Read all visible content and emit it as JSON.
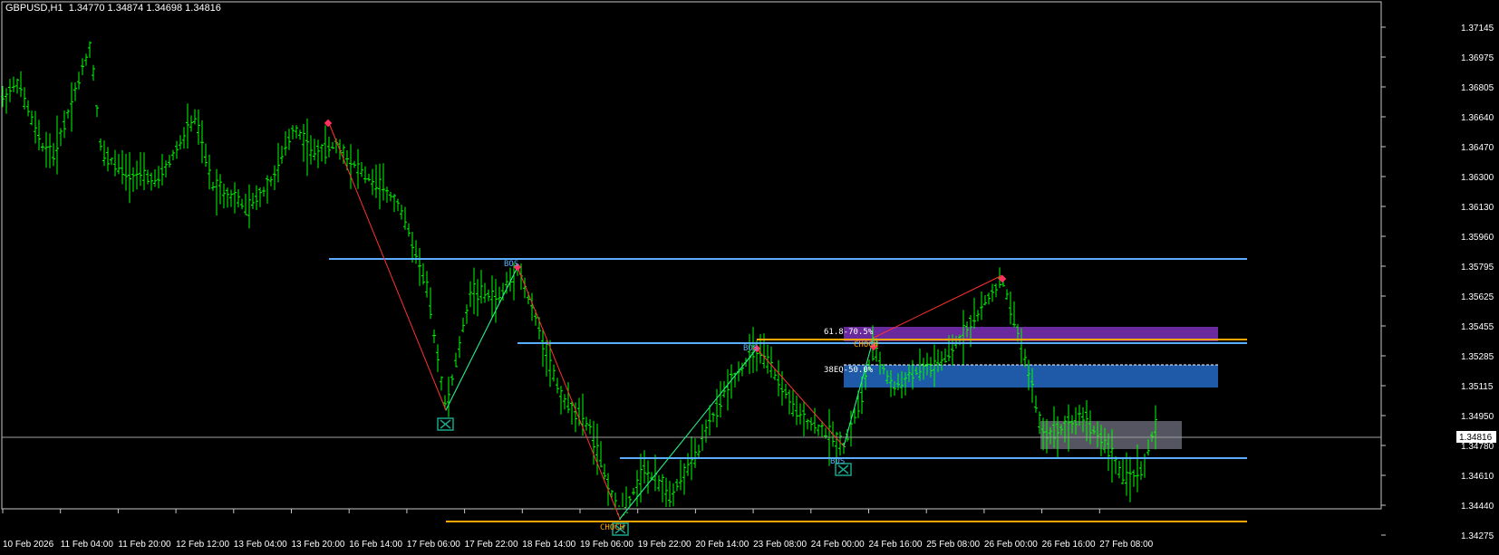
{
  "header": {
    "symbol": "GBPUSD,H1",
    "ohlc": "1.34770 1.34874 1.34698 1.34816"
  },
  "colors": {
    "background": "#000000",
    "candle": "#00ff00",
    "bos_line": "#5aaeff",
    "choch_line": "#ffa500",
    "zigzag_up": "#00ff90",
    "zigzag_down": "#ff3030",
    "fib_zone": "#6a2a9e",
    "eq_zone": "#1e5aa8",
    "ob_zone": "#6a6a7a",
    "marker": "#19a589"
  },
  "price_axis": {
    "labels": [
      "1.37145",
      "1.36975",
      "1.36805",
      "1.36640",
      "1.36470",
      "1.36300",
      "1.36130",
      "1.35960",
      "1.35795",
      "1.35625",
      "1.35455",
      "1.35285",
      "1.35115",
      "1.34950",
      "1.34780",
      "1.34610",
      "1.34440",
      "1.34275"
    ],
    "current_price": "1.34816"
  },
  "time_axis": {
    "labels": [
      "10 Feb 2026",
      "11 Feb 04:00",
      "11 Feb 20:00",
      "12 Feb 12:00",
      "13 Feb 04:00",
      "13 Feb 20:00",
      "16 Feb 14:00",
      "17 Feb 06:00",
      "17 Feb 22:00",
      "18 Feb 14:00",
      "19 Feb 06:00",
      "19 Feb 22:00",
      "20 Feb 14:00",
      "23 Feb 08:00",
      "24 Feb 00:00",
      "24 Feb 16:00",
      "25 Feb 08:00",
      "26 Feb 00:00",
      "26 Feb 16:00",
      "27 Feb 08:00"
    ]
  },
  "annotations": {
    "bos": "BOS",
    "choch": "CHOCH",
    "fib": "61.8-70.5%",
    "eq": "38EQ-50.0%"
  }
}
